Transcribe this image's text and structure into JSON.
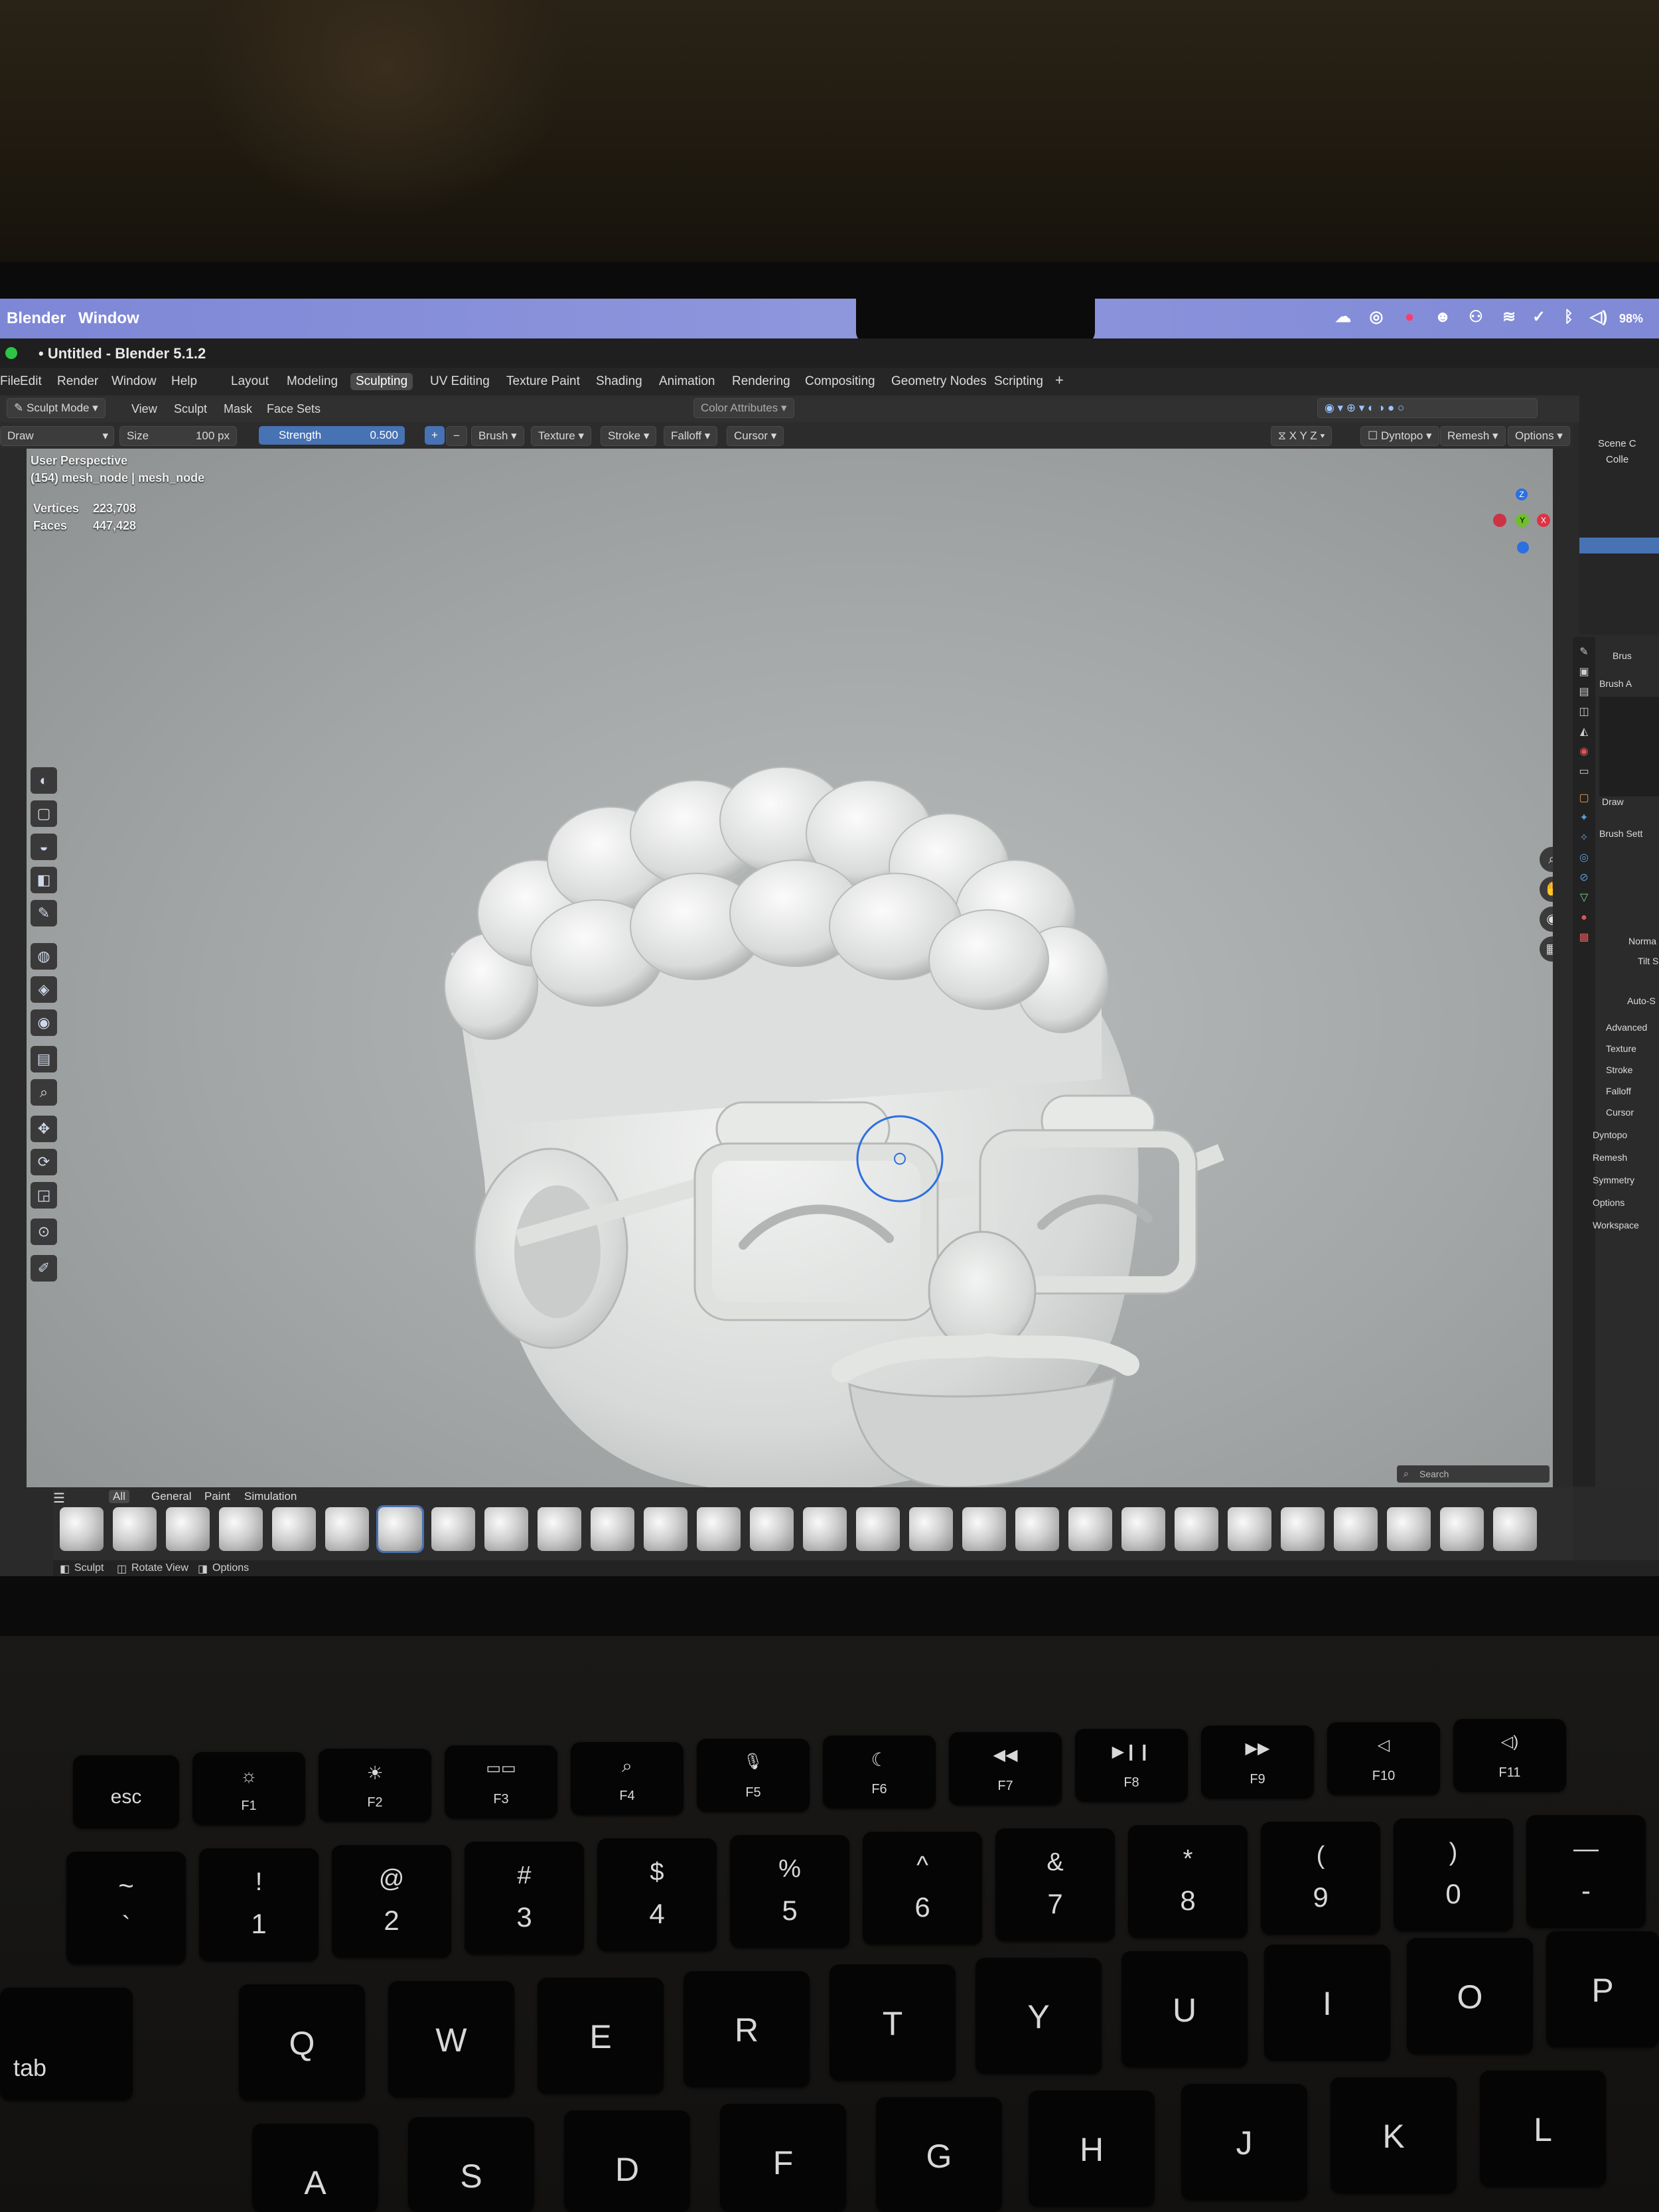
{
  "mac_menubar": {
    "app": "Blender",
    "window": "Window",
    "battery": "98%"
  },
  "window_title": "• Untitled - Blender 5.1.2",
  "menus": [
    "File",
    "Edit",
    "Render",
    "Window",
    "Help"
  ],
  "workspaces": [
    "Layout",
    "Modeling",
    "Sculpting",
    "UV Editing",
    "Texture Paint",
    "Shading",
    "Animation",
    "Rendering",
    "Compositing",
    "Geometry Nodes",
    "Scripting",
    "+"
  ],
  "active_workspace": "Sculpting",
  "header": {
    "mode": "Sculpt Mode",
    "view": "View",
    "sculpt": "Sculpt",
    "mask": "Mask",
    "face_sets": "Face Sets",
    "color_attributes": "Color Attributes"
  },
  "tool_settings": {
    "brush_name": "Draw",
    "size_label": "Size",
    "size_value": "100 px",
    "strength_label": "Strength",
    "strength_value": "0.500",
    "brush": "Brush",
    "texture": "Texture",
    "stroke": "Stroke",
    "falloff": "Falloff",
    "cursor": "Cursor",
    "x": "X",
    "y": "Y",
    "z": "Z",
    "dyntopo": "Dyntopo",
    "remesh": "Remesh",
    "options": "Options"
  },
  "viewport": {
    "perspective": "User Perspective",
    "object": "(154) mesh_node | mesh_node",
    "vertices_label": "Vertices",
    "vertices_value": "223,708",
    "faces_label": "Faces",
    "faces_value": "447,428",
    "search_placeholder": "Search"
  },
  "shelf": {
    "tabs": [
      "All",
      "General",
      "Paint",
      "Simulation"
    ]
  },
  "status": {
    "sculpt": "Sculpt",
    "rotate": "Rotate View",
    "options": "Options"
  },
  "outliner": {
    "scene": "Scene C",
    "collection": "Colle"
  },
  "properties": {
    "brush": "Brus",
    "brush_asset": "Brush A",
    "draw": "Draw",
    "brush_settings": "Brush Sett",
    "normal": "Norma",
    "tilt": "Tilt S",
    "auto": "Auto-S",
    "sections": [
      "Advanced",
      "Texture",
      "Stroke",
      "Falloff",
      "Cursor",
      "Dyntopo",
      "Remesh",
      "Symmetry",
      "Options",
      "Workspace"
    ]
  },
  "keyboard": {
    "fn_row": [
      {
        "top": "",
        "bottom": "esc"
      },
      {
        "top": "☼",
        "bottom": "F1"
      },
      {
        "top": "☀",
        "bottom": "F2"
      },
      {
        "top": "▭▭",
        "bottom": "F3"
      },
      {
        "top": "⌕",
        "bottom": "F4"
      },
      {
        "top": "🎙",
        "bottom": "F5"
      },
      {
        "top": "☾",
        "bottom": "F6"
      },
      {
        "top": "◀◀",
        "bottom": "F7"
      },
      {
        "top": "▶❙❙",
        "bottom": "F8"
      },
      {
        "top": "▶▶",
        "bottom": "F9"
      },
      {
        "top": "◁",
        "bottom": "F10"
      },
      {
        "top": "◁)",
        "bottom": "F11"
      }
    ],
    "num_row": [
      {
        "top": "~",
        "bottom": "`"
      },
      {
        "top": "!",
        "bottom": "1"
      },
      {
        "top": "@",
        "bottom": "2"
      },
      {
        "top": "#",
        "bottom": "3"
      },
      {
        "top": "$",
        "bottom": "4"
      },
      {
        "top": "%",
        "bottom": "5"
      },
      {
        "top": "^",
        "bottom": "6"
      },
      {
        "top": "&",
        "bottom": "7"
      },
      {
        "top": "*",
        "bottom": "8"
      },
      {
        "top": "(",
        "bottom": "9"
      },
      {
        "top": ")",
        "bottom": "0"
      },
      {
        "top": "—",
        "bottom": "-"
      }
    ],
    "qwerty_row": [
      "tab",
      "Q",
      "W",
      "E",
      "R",
      "T",
      "Y",
      "U",
      "I",
      "O",
      "P"
    ],
    "asdf_row": [
      "A",
      "S",
      "D",
      "F",
      "G",
      "H",
      "J",
      "K",
      "L"
    ]
  },
  "colors": {
    "accent": "#4772b3",
    "mac_menubar": "#8891d9",
    "viewport_bg": "#a8abab",
    "sculpt": "#e6e8e6"
  },
  "icons": [
    "cloud-icon",
    "record-icon",
    "wifi-icon",
    "bluetooth-icon",
    "volume-icon",
    "battery-icon",
    "brush-icon",
    "zoom-icon",
    "hand-icon",
    "camera-icon",
    "grid-icon"
  ]
}
